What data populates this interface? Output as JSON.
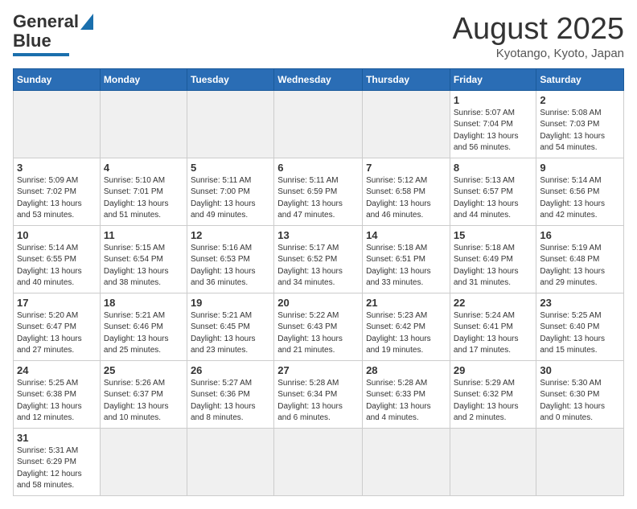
{
  "header": {
    "logo_main": "General",
    "logo_blue": "Blue",
    "month_title": "August 2025",
    "location": "Kyotango, Kyoto, Japan"
  },
  "weekdays": [
    "Sunday",
    "Monday",
    "Tuesday",
    "Wednesday",
    "Thursday",
    "Friday",
    "Saturday"
  ],
  "weeks": [
    [
      {
        "day": "",
        "info": "",
        "empty": true
      },
      {
        "day": "",
        "info": "",
        "empty": true
      },
      {
        "day": "",
        "info": "",
        "empty": true
      },
      {
        "day": "",
        "info": "",
        "empty": true
      },
      {
        "day": "",
        "info": "",
        "empty": true
      },
      {
        "day": "1",
        "info": "Sunrise: 5:07 AM\nSunset: 7:04 PM\nDaylight: 13 hours\nand 56 minutes."
      },
      {
        "day": "2",
        "info": "Sunrise: 5:08 AM\nSunset: 7:03 PM\nDaylight: 13 hours\nand 54 minutes."
      }
    ],
    [
      {
        "day": "3",
        "info": "Sunrise: 5:09 AM\nSunset: 7:02 PM\nDaylight: 13 hours\nand 53 minutes."
      },
      {
        "day": "4",
        "info": "Sunrise: 5:10 AM\nSunset: 7:01 PM\nDaylight: 13 hours\nand 51 minutes."
      },
      {
        "day": "5",
        "info": "Sunrise: 5:11 AM\nSunset: 7:00 PM\nDaylight: 13 hours\nand 49 minutes."
      },
      {
        "day": "6",
        "info": "Sunrise: 5:11 AM\nSunset: 6:59 PM\nDaylight: 13 hours\nand 47 minutes."
      },
      {
        "day": "7",
        "info": "Sunrise: 5:12 AM\nSunset: 6:58 PM\nDaylight: 13 hours\nand 46 minutes."
      },
      {
        "day": "8",
        "info": "Sunrise: 5:13 AM\nSunset: 6:57 PM\nDaylight: 13 hours\nand 44 minutes."
      },
      {
        "day": "9",
        "info": "Sunrise: 5:14 AM\nSunset: 6:56 PM\nDaylight: 13 hours\nand 42 minutes."
      }
    ],
    [
      {
        "day": "10",
        "info": "Sunrise: 5:14 AM\nSunset: 6:55 PM\nDaylight: 13 hours\nand 40 minutes."
      },
      {
        "day": "11",
        "info": "Sunrise: 5:15 AM\nSunset: 6:54 PM\nDaylight: 13 hours\nand 38 minutes."
      },
      {
        "day": "12",
        "info": "Sunrise: 5:16 AM\nSunset: 6:53 PM\nDaylight: 13 hours\nand 36 minutes."
      },
      {
        "day": "13",
        "info": "Sunrise: 5:17 AM\nSunset: 6:52 PM\nDaylight: 13 hours\nand 34 minutes."
      },
      {
        "day": "14",
        "info": "Sunrise: 5:18 AM\nSunset: 6:51 PM\nDaylight: 13 hours\nand 33 minutes."
      },
      {
        "day": "15",
        "info": "Sunrise: 5:18 AM\nSunset: 6:49 PM\nDaylight: 13 hours\nand 31 minutes."
      },
      {
        "day": "16",
        "info": "Sunrise: 5:19 AM\nSunset: 6:48 PM\nDaylight: 13 hours\nand 29 minutes."
      }
    ],
    [
      {
        "day": "17",
        "info": "Sunrise: 5:20 AM\nSunset: 6:47 PM\nDaylight: 13 hours\nand 27 minutes."
      },
      {
        "day": "18",
        "info": "Sunrise: 5:21 AM\nSunset: 6:46 PM\nDaylight: 13 hours\nand 25 minutes."
      },
      {
        "day": "19",
        "info": "Sunrise: 5:21 AM\nSunset: 6:45 PM\nDaylight: 13 hours\nand 23 minutes."
      },
      {
        "day": "20",
        "info": "Sunrise: 5:22 AM\nSunset: 6:43 PM\nDaylight: 13 hours\nand 21 minutes."
      },
      {
        "day": "21",
        "info": "Sunrise: 5:23 AM\nSunset: 6:42 PM\nDaylight: 13 hours\nand 19 minutes."
      },
      {
        "day": "22",
        "info": "Sunrise: 5:24 AM\nSunset: 6:41 PM\nDaylight: 13 hours\nand 17 minutes."
      },
      {
        "day": "23",
        "info": "Sunrise: 5:25 AM\nSunset: 6:40 PM\nDaylight: 13 hours\nand 15 minutes."
      }
    ],
    [
      {
        "day": "24",
        "info": "Sunrise: 5:25 AM\nSunset: 6:38 PM\nDaylight: 13 hours\nand 12 minutes."
      },
      {
        "day": "25",
        "info": "Sunrise: 5:26 AM\nSunset: 6:37 PM\nDaylight: 13 hours\nand 10 minutes."
      },
      {
        "day": "26",
        "info": "Sunrise: 5:27 AM\nSunset: 6:36 PM\nDaylight: 13 hours\nand 8 minutes."
      },
      {
        "day": "27",
        "info": "Sunrise: 5:28 AM\nSunset: 6:34 PM\nDaylight: 13 hours\nand 6 minutes."
      },
      {
        "day": "28",
        "info": "Sunrise: 5:28 AM\nSunset: 6:33 PM\nDaylight: 13 hours\nand 4 minutes."
      },
      {
        "day": "29",
        "info": "Sunrise: 5:29 AM\nSunset: 6:32 PM\nDaylight: 13 hours\nand 2 minutes."
      },
      {
        "day": "30",
        "info": "Sunrise: 5:30 AM\nSunset: 6:30 PM\nDaylight: 13 hours\nand 0 minutes."
      }
    ],
    [
      {
        "day": "31",
        "info": "Sunrise: 5:31 AM\nSunset: 6:29 PM\nDaylight: 12 hours\nand 58 minutes."
      },
      {
        "day": "",
        "info": "",
        "empty": true
      },
      {
        "day": "",
        "info": "",
        "empty": true
      },
      {
        "day": "",
        "info": "",
        "empty": true
      },
      {
        "day": "",
        "info": "",
        "empty": true
      },
      {
        "day": "",
        "info": "",
        "empty": true
      },
      {
        "day": "",
        "info": "",
        "empty": true
      }
    ]
  ]
}
